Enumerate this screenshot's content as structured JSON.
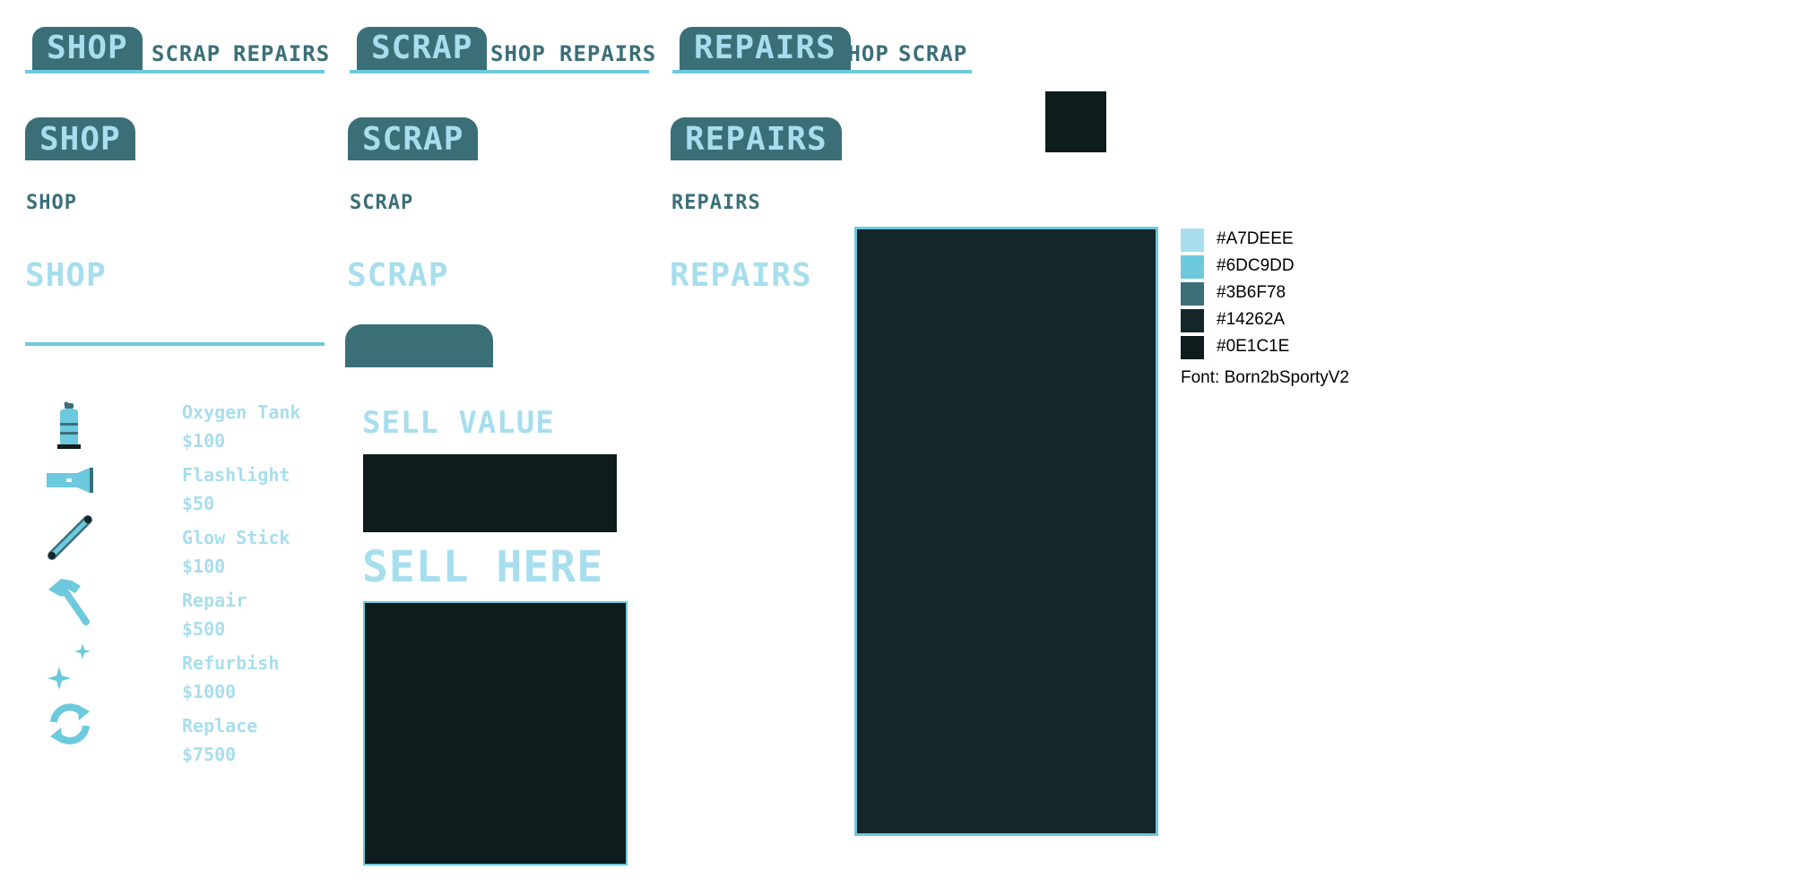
{
  "tab_bars": [
    {
      "active": "SHOP",
      "others": [
        "SCRAP",
        "REPAIRS"
      ]
    },
    {
      "active": "SCRAP",
      "others": [
        "SHOP",
        "REPAIRS"
      ]
    },
    {
      "active": "REPAIRS",
      "others": [
        "SHOP",
        "SCRAP"
      ]
    }
  ],
  "headers": {
    "tab_style": [
      "SHOP",
      "SCRAP",
      "REPAIRS"
    ],
    "small_style": [
      "SHOP",
      "SCRAP",
      "REPAIRS"
    ],
    "large_style": [
      "SHOP",
      "SCRAP",
      "REPAIRS"
    ]
  },
  "shop_items": [
    {
      "icon": "oxygen-tank-icon",
      "name": "Oxygen Tank",
      "price": "$100"
    },
    {
      "icon": "flashlight-icon",
      "name": "Flashlight",
      "price": "$50"
    },
    {
      "icon": "glow-stick-icon",
      "name": "Glow Stick",
      "price": "$100"
    },
    {
      "icon": "hammer-icon",
      "name": "Repair",
      "price": "$500"
    },
    {
      "icon": "sparkle-icon",
      "name": "Refurbish",
      "price": "$1000"
    },
    {
      "icon": "refresh-icon",
      "name": "Replace",
      "price": "$7500"
    }
  ],
  "sell_panel": {
    "value_label": "SELL VALUE",
    "drop_label": "SELL HERE"
  },
  "palette": [
    {
      "hex": "#A7DEEE",
      "label": "#A7DEEE"
    },
    {
      "hex": "#6DC9DD",
      "label": "#6DC9DD"
    },
    {
      "hex": "#3B6F78",
      "label": "#3B6F78"
    },
    {
      "hex": "#14262A",
      "label": "#14262A"
    },
    {
      "hex": "#0E1C1E",
      "label": "#0E1C1E"
    }
  ],
  "font_label": "Font: Born2bSportyV2"
}
